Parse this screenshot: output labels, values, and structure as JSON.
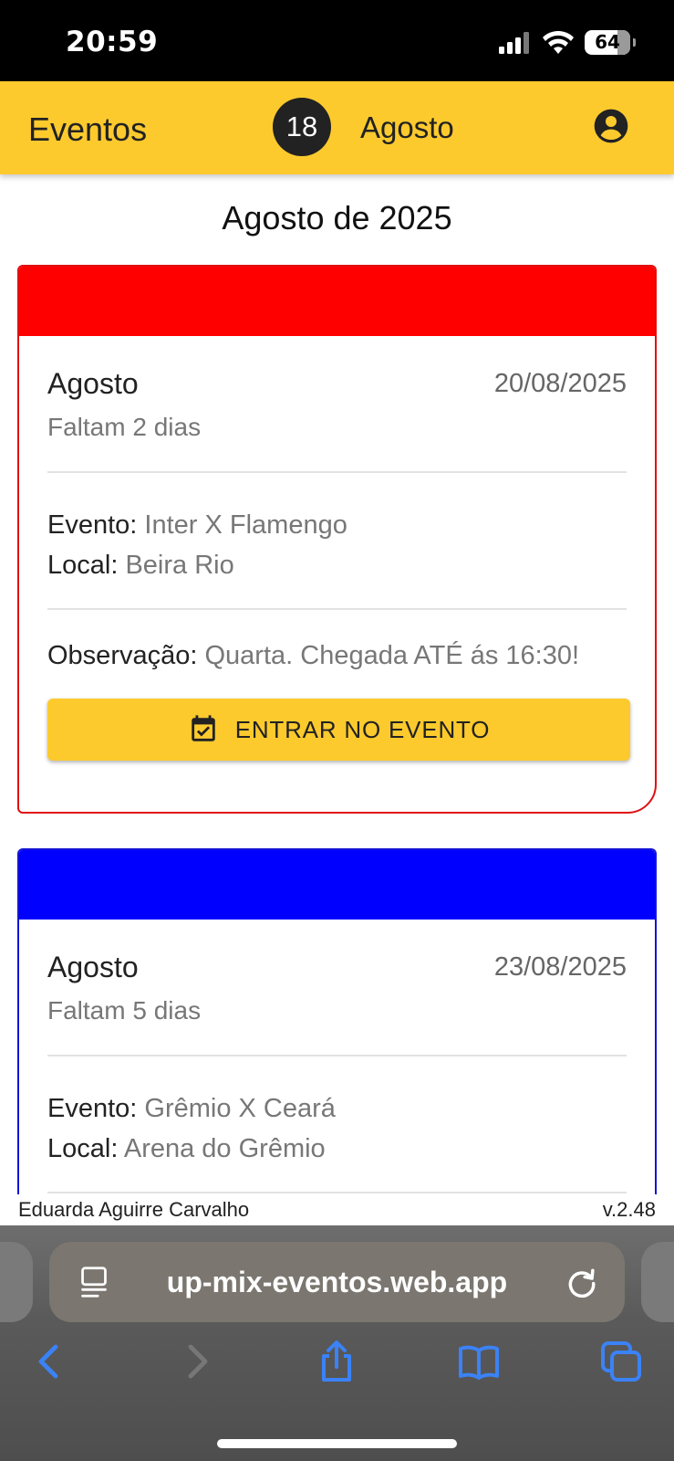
{
  "status_bar": {
    "time": "20:59",
    "battery": "64",
    "icons": [
      "signal-icon",
      "wifi-icon",
      "battery-icon"
    ]
  },
  "app_bar": {
    "title": "Eventos",
    "badge_count": "18",
    "month": "Agosto",
    "account_icon": "account-circle-icon",
    "color": "#fdca2e"
  },
  "page": {
    "heading": "Agosto de 2025"
  },
  "events": [
    {
      "header_color": "#ff0000",
      "month": "Agosto",
      "date": "20/08/2025",
      "countdown": "Faltam 2 dias",
      "event_label": "Evento:",
      "event_value": "Inter X Flamengo",
      "local_label": "Local:",
      "local_value": "Beira Rio",
      "obs_label": "Observação:",
      "obs_value": "Quarta. Chegada ATÉ ás 16:30!",
      "button_label": "ENTRAR NO EVENTO",
      "button_icon": "calendar-check-icon"
    },
    {
      "header_color": "#0000ff",
      "month": "Agosto",
      "date": "23/08/2025",
      "countdown": "Faltam 5 dias",
      "event_label": "Evento:",
      "event_value": "Grêmio X Ceará",
      "local_label": "Local:",
      "local_value": "Arena do Grêmio"
    }
  ],
  "footer": {
    "user_name": "Eduarda Aguirre Carvalho",
    "version": "v.2.48"
  },
  "browser": {
    "url": "up-mix-eventos.web.app",
    "icons": [
      "page-menu-icon",
      "reload-icon",
      "back-icon",
      "forward-icon",
      "share-icon",
      "bookmarks-icon",
      "tabs-icon"
    ],
    "accent_color": "#3b82f6"
  }
}
